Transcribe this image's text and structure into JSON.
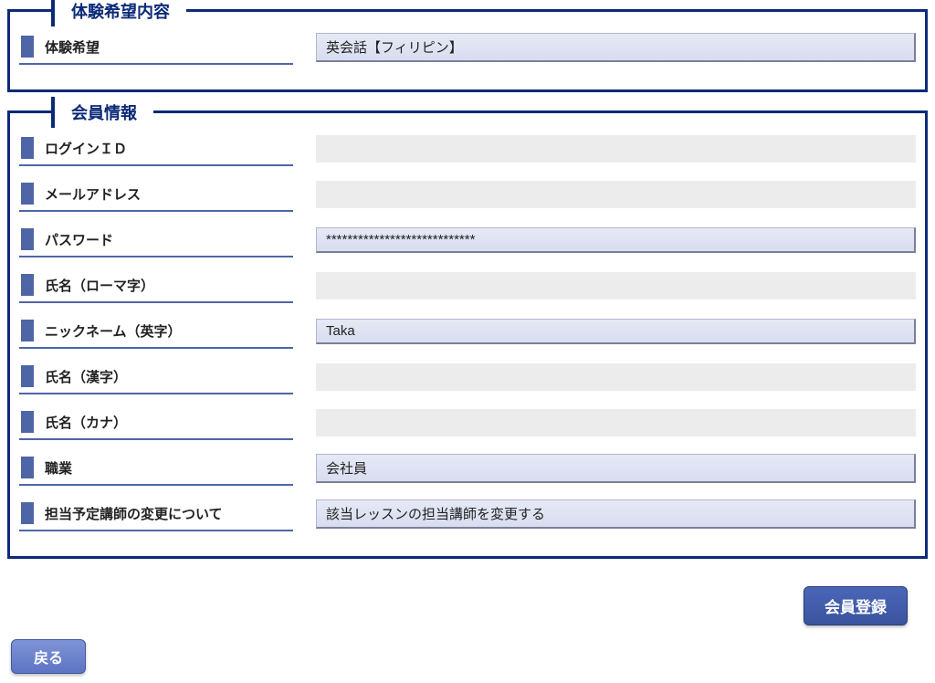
{
  "sections": {
    "trial": {
      "legend": "体験希望内容",
      "rows": [
        {
          "label": "体験希望",
          "value": "英会話【フィリピン】",
          "style": "box"
        }
      ]
    },
    "member": {
      "legend": "会員情報",
      "rows": [
        {
          "label": "ログインＩＤ",
          "value": "",
          "style": "plain"
        },
        {
          "label": "メールアドレス",
          "value": "",
          "style": "plain"
        },
        {
          "label": "パスワード",
          "value": "****************************",
          "style": "box"
        },
        {
          "label": "氏名（ローマ字）",
          "value": "",
          "style": "plain"
        },
        {
          "label": "ニックネーム（英字）",
          "value": "Taka",
          "style": "box"
        },
        {
          "label": "氏名（漢字）",
          "value": "",
          "style": "plain"
        },
        {
          "label": "氏名（カナ）",
          "value": "",
          "style": "plain"
        },
        {
          "label": "職業",
          "value": "会社員",
          "style": "box"
        },
        {
          "label": "担当予定講師の変更について",
          "value": "該当レッスンの担当講師を変更する",
          "style": "box"
        }
      ]
    }
  },
  "buttons": {
    "register": "会員登録",
    "back": "戻る"
  }
}
